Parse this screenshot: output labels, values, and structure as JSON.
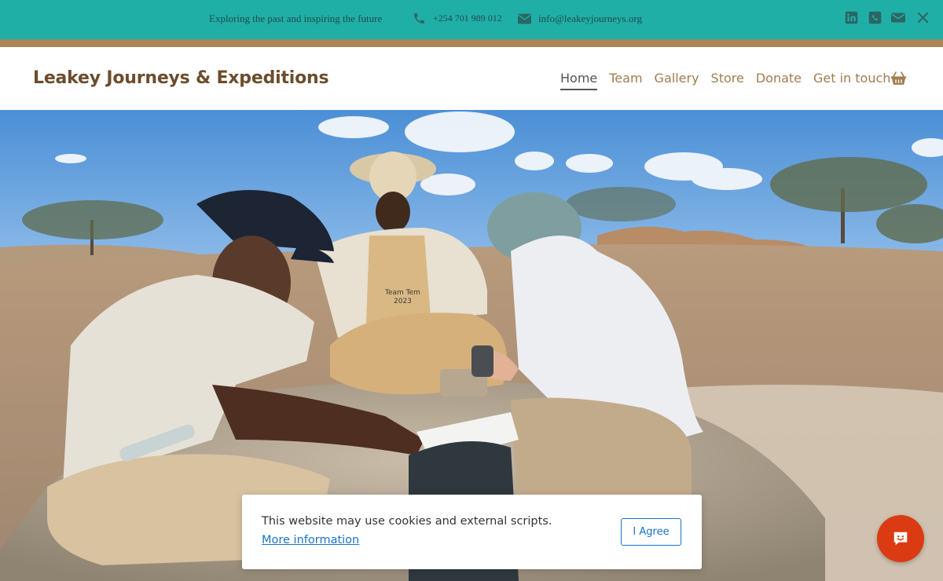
{
  "topbar": {
    "tagline": "Exploring the past and inspiring the future",
    "phone": "+254 701 989 012",
    "email": "info@leakeyjourneys.org",
    "phone_icon": "phone-icon",
    "mail_icon": "envelope-icon",
    "social": [
      "linkedin-icon",
      "whatsapp-icon",
      "email-icon",
      "x-icon"
    ],
    "color": "#1fafa7"
  },
  "header": {
    "brand": "Leakey Journeys & Expeditions",
    "nav": [
      {
        "label": "Home",
        "active": true
      },
      {
        "label": "Team",
        "active": false
      },
      {
        "label": "Gallery",
        "active": false
      },
      {
        "label": "Store",
        "active": false
      },
      {
        "label": "Donate",
        "active": false
      },
      {
        "label": "Get in touch",
        "active": false
      }
    ],
    "cart_icon": "shopping-basket-icon",
    "brand_color": "#6b4d2d",
    "nav_color": "#a07d4f"
  },
  "hero": {
    "image": "field-researchers-photo",
    "team_text_line1": "Team Tem",
    "team_text_line2": "2023"
  },
  "cookie": {
    "text": "This website may use cookies and external scripts.",
    "link": "More information",
    "button": "I Agree"
  },
  "chat": {
    "icon": "chat-smile-icon",
    "color": "#db3b12"
  }
}
